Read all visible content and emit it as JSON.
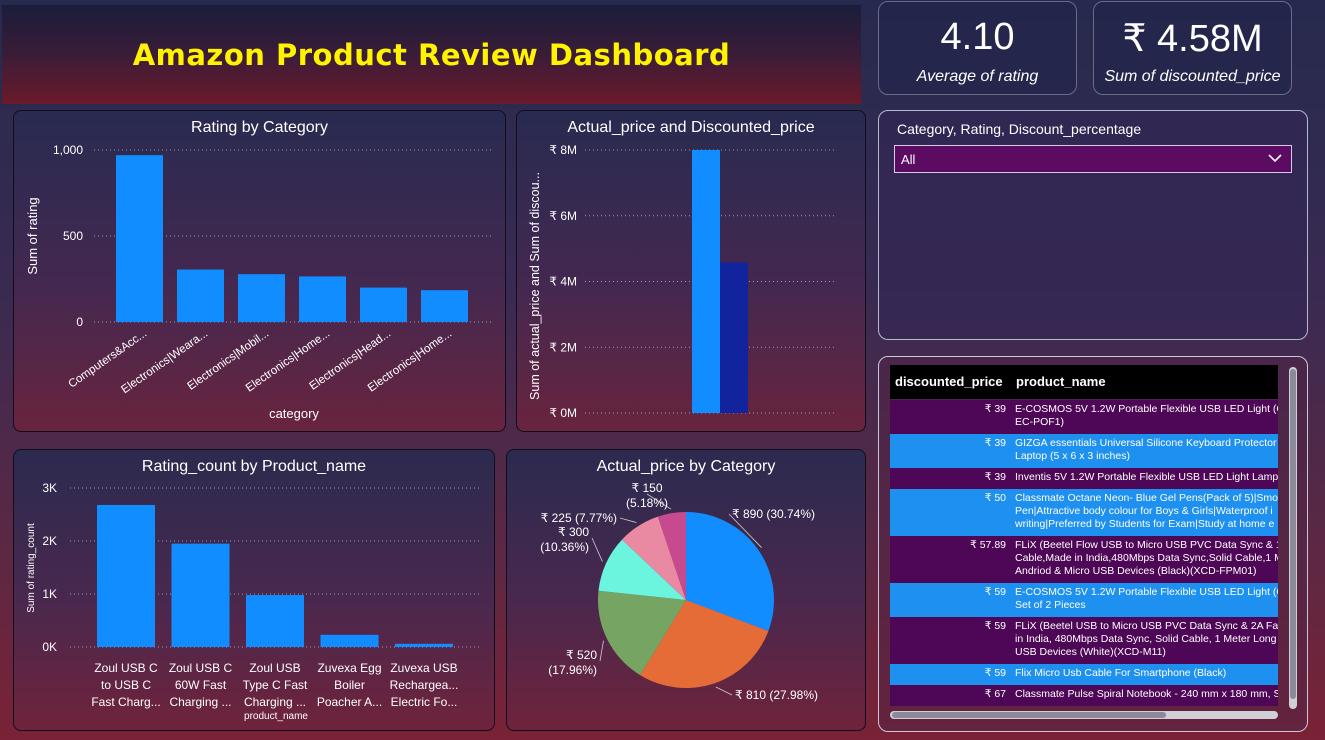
{
  "header": {
    "title": "Amazon Product Review Dashboard"
  },
  "kpis": [
    {
      "value": "4.10",
      "label": "Average of rating"
    },
    {
      "value": "₹ 4.58M",
      "label": "Sum of discounted_price"
    }
  ],
  "slicer": {
    "title": "Category, Rating, Discount_percentage",
    "selected": "All"
  },
  "colors": {
    "bar_blue": "#118dff",
    "bar_navy": "#12239e",
    "slicer_bg": "#5c0b63",
    "title_yellow": "#fff300"
  },
  "table": {
    "columns": [
      "discounted_price",
      "product_name"
    ],
    "rows": [
      {
        "price": "₹ 39",
        "lines": [
          "E-COSMOS 5V 1.2W Portable Flexible USB LED Light (Co",
          "EC-POF1)"
        ]
      },
      {
        "price": "₹ 39",
        "lines": [
          "GIZGA essentials Universal Silicone Keyboard Protector S",
          "Laptop (5 x 6 x 3 inches)"
        ]
      },
      {
        "price": "₹ 39",
        "lines": [
          "Inventis 5V 1.2W Portable Flexible USB LED Light Lamp ("
        ]
      },
      {
        "price": "₹ 50",
        "lines": [
          "Classmate Octane Neon- Blue Gel Pens(Pack of 5)|Smoo",
          "Pen|Attractive body colour for Boys & Girls|Waterproof i",
          "writing|Preferred by Students for Exam|Study at home e"
        ]
      },
      {
        "price": "₹ 57.89",
        "lines": [
          "FLiX (Beetel Flow USB to Micro USB PVC Data Sync & 12",
          "Cable,Made in India,480Mbps Data Sync,Solid Cable,1 M",
          "Andriod & Micro USB Devices (Black)(XCD-FPM01)"
        ]
      },
      {
        "price": "₹ 59",
        "lines": [
          "E-COSMOS 5V 1.2W Portable Flexible USB LED Light (Co",
          "Set of 2 Pieces"
        ]
      },
      {
        "price": "₹ 59",
        "lines": [
          "FLiX (Beetel USB to Micro USB PVC Data Sync & 2A Fast",
          "in India, 480Mbps Data Sync, Solid Cable, 1 Meter Long",
          "USB Devices (White)(XCD-M11)"
        ]
      },
      {
        "price": "₹ 59",
        "lines": [
          "Flix Micro Usb Cable For Smartphone (Black)"
        ]
      },
      {
        "price": "₹ 67",
        "lines": [
          "Classmate Pulse Spiral Notebook - 240 mm x 180 mm, S"
        ]
      }
    ]
  },
  "chart_data": [
    {
      "type": "bar",
      "title": "Rating by Category",
      "xlabel": "category",
      "ylabel": "Sum of rating",
      "categories": [
        "Computers&Acc...",
        "Electronics|Weara...",
        "Electronics|Mobil...",
        "Electronics|Home...",
        "Electronics|Head...",
        "Electronics|Home..."
      ],
      "values": [
        970,
        305,
        278,
        265,
        200,
        185
      ],
      "ylim": [
        0,
        1000
      ],
      "yticks": [
        "0",
        "500",
        "1,000"
      ],
      "grid": true
    },
    {
      "type": "bar",
      "title": "Actual_price and Discounted_price",
      "ylabel": "Sum of actual_price and Sum of discou...",
      "series": [
        {
          "name": "actual_price",
          "values": [
            8000000
          ],
          "color": "#118dff"
        },
        {
          "name": "discounted_price",
          "values": [
            4580000
          ],
          "color": "#12239e"
        }
      ],
      "ylim": [
        0,
        8000000
      ],
      "yticks": [
        "₹ 0M",
        "₹ 2M",
        "₹ 4M",
        "₹ 6M",
        "₹ 8M"
      ],
      "grid": true
    },
    {
      "type": "bar",
      "title": "Rating_count by Product_name",
      "xlabel": "product_name",
      "ylabel": "Sum of rating_count",
      "categories": [
        [
          "Zoul USB C",
          "to USB C",
          "Fast Charg..."
        ],
        [
          "Zoul USB C",
          "60W Fast",
          "Charging ..."
        ],
        [
          "Zoul USB",
          "Type C Fast",
          "Charging ..."
        ],
        [
          "Zuvexa Egg",
          "Boiler",
          "Poacher A..."
        ],
        [
          "Zuvexa USB",
          "Rechargea...",
          "Electric Fo..."
        ]
      ],
      "values": [
        2680,
        1950,
        980,
        230,
        60
      ],
      "ylim": [
        0,
        3000
      ],
      "yticks": [
        "0K",
        "1K",
        "2K",
        "3K"
      ],
      "grid": true
    },
    {
      "type": "pie",
      "title": "Actual_price by Category",
      "slices": [
        {
          "label": "₹ 890 (30.74%)",
          "value": 890,
          "color": "#118dff"
        },
        {
          "label": "₹ 810 (27.98%)",
          "value": 810,
          "color": "#e66c37"
        },
        {
          "label": "₹ 520 (17.96%)",
          "value": 520,
          "color": "#76a563"
        },
        {
          "label": "₹ 300 (10.36%)",
          "value": 300,
          "color": "#6bf5de"
        },
        {
          "label": "₹ 225 (7.77%)",
          "value": 225,
          "color": "#ea8aa2"
        },
        {
          "label": "₹ 150 (5.18%)",
          "value": 150,
          "color": "#c84a8e"
        }
      ]
    }
  ]
}
